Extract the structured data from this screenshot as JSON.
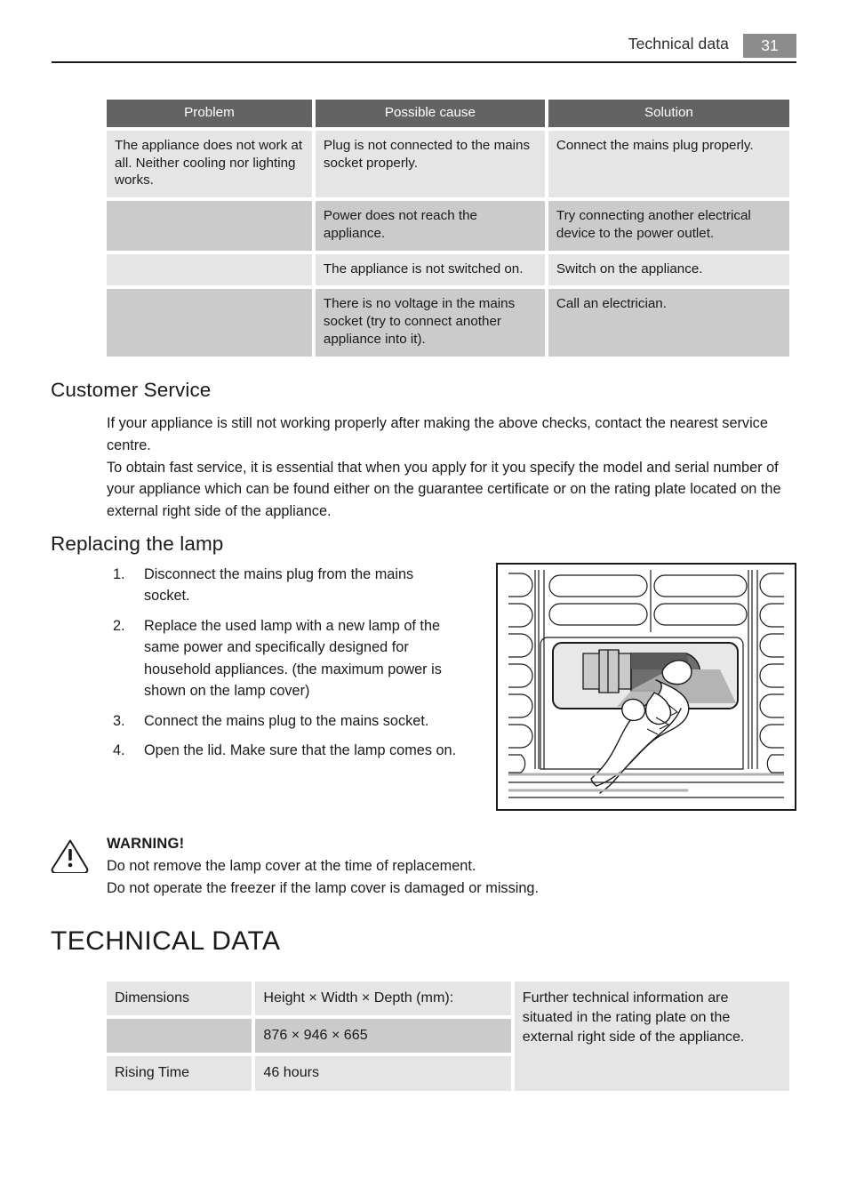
{
  "header": {
    "title": "Technical data",
    "page_number": "31",
    "badge_color": "#8c8c8c"
  },
  "troubleshooting_table": {
    "headers": [
      "Problem",
      "Possible cause",
      "Solution"
    ],
    "rows": [
      {
        "problem": "The appliance does not work at all. Neither cooling nor lighting works.",
        "cause": "Plug is not connected to the mains socket properly.",
        "solution": "Connect the mains plug properly."
      },
      {
        "problem": "",
        "cause": "Power does not reach the appliance.",
        "solution": "Try connecting another electrical device to the power outlet."
      },
      {
        "problem": "",
        "cause": "The appliance is not switched on.",
        "solution": "Switch on the appliance."
      },
      {
        "problem": "",
        "cause": "There is no voltage in the mains socket (try to connect another appliance into it).",
        "solution": "Call an electrician."
      }
    ],
    "header_bg": "#636363",
    "band_light": "#e5e5e5",
    "band_dark": "#cbcbcb"
  },
  "customer_service": {
    "heading": "Customer Service",
    "paragraphs": [
      "If your appliance is still not working properly after making the above checks, contact the nearest service centre.",
      "To obtain fast service, it is essential that when you apply for it you specify the model and serial number of your appliance which can be found either on the guarantee certificate or on the rating plate located on the external right side of the appliance."
    ]
  },
  "replacing_lamp": {
    "heading": "Replacing the lamp",
    "steps": [
      {
        "marker": "1.",
        "text": "Disconnect the mains plug from the mains socket."
      },
      {
        "marker": "2.",
        "text": "Replace the used lamp with a new lamp of the same power and specifically designed for household appliances. (the maximum power is shown on the lamp cover)"
      },
      {
        "marker": "3.",
        "text": "Connect the mains plug to the mains socket."
      },
      {
        "marker": "4.",
        "text": "Open the lid. Make sure that the lamp comes on."
      }
    ],
    "illustration_caption": "hand-replacing-freezer-lamp"
  },
  "warning": {
    "icon": "warning-triangle-icon",
    "title": "WARNING!",
    "lines": [
      "Do not remove the lamp cover at the time of replacement.",
      "Do not operate the freezer if the lamp cover is damaged or missing."
    ]
  },
  "technical_data": {
    "heading": "TECHNICAL DATA",
    "rows": [
      {
        "label": "Dimensions",
        "value": "Height × Width × Depth (mm):"
      },
      {
        "label": "",
        "value": "876 × 946 × 665"
      },
      {
        "label": "Rising Time",
        "value": "46 hours"
      }
    ],
    "note": "Further technical information are situated in the rating plate on the external right side of the appliance."
  }
}
